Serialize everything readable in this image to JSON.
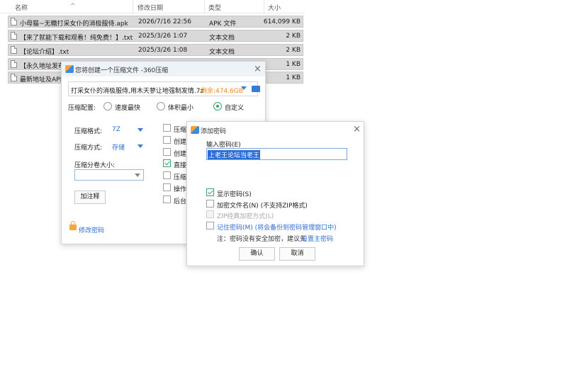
{
  "file_list": {
    "columns": {
      "name": "名称",
      "date": "修改日期",
      "type": "类型",
      "size": "大小"
    },
    "rows": [
      {
        "name": "小母猫~无糖打采女仆的消极服侍.apk",
        "date": "2026/7/16 22:56",
        "type": "APK 文件",
        "size": "614,099 KB"
      },
      {
        "name": "【来了就能下载和观看！纯免费！】.txt",
        "date": "2025/3/26 1:07",
        "type": "文本文档",
        "size": "2 KB"
      },
      {
        "name": "【论坛介绍】.txt",
        "date": "2025/3/26 1:08",
        "type": "文本文档",
        "size": "2 KB"
      },
      {
        "name": "【永久地址发布页】",
        "date": "",
        "type": "",
        "size": "1 KB"
      },
      {
        "name": "最新地址及APP",
        "date": "",
        "type": "",
        "size": "1 KB"
      }
    ]
  },
  "compress_dialog": {
    "title": "您将创建一个压缩文件 -360压缩",
    "path": "打采女仆的消极服侍,用木天蓼让地强制发情.7z",
    "free_space": "剩余:474.6GB",
    "config_label": "压缩配置:",
    "options": [
      "速度最快",
      "体积最小",
      "自定义"
    ],
    "selected_option": "自定义",
    "format_label": "压缩格式:",
    "format_value": "7Z",
    "method_label": "压缩方式:",
    "method_value": "存储",
    "split_label": "压缩分卷大小:",
    "split_value": "",
    "annotate_button": "加注释",
    "checkboxes": [
      {
        "label": "压缩",
        "checked": false
      },
      {
        "label": "创建",
        "checked": false
      },
      {
        "label": "创建",
        "checked": false
      },
      {
        "label": "直接",
        "checked": true
      },
      {
        "label": "压缩",
        "checked": false
      },
      {
        "label": "操作",
        "checked": false
      },
      {
        "label": "后台",
        "checked": false
      }
    ],
    "change_password_link": "修改密码"
  },
  "password_dialog": {
    "title": "添加密码",
    "input_label": "输入密码(E)",
    "password_value": "上老王论坛当老王",
    "show_password": "显示密码(S)",
    "encrypt_filenames": "加密文件名(N) (不支持ZIP格式)",
    "zip_classic": "ZIP经典加密方式(L)",
    "remember_password": "记住密码(M) (将会备份到密码管理窗口中)",
    "note_prefix": "注：密码没有安全加密，建议先",
    "note_link": "设置主密码",
    "ok_button": "确认",
    "cancel_button": "取消"
  }
}
